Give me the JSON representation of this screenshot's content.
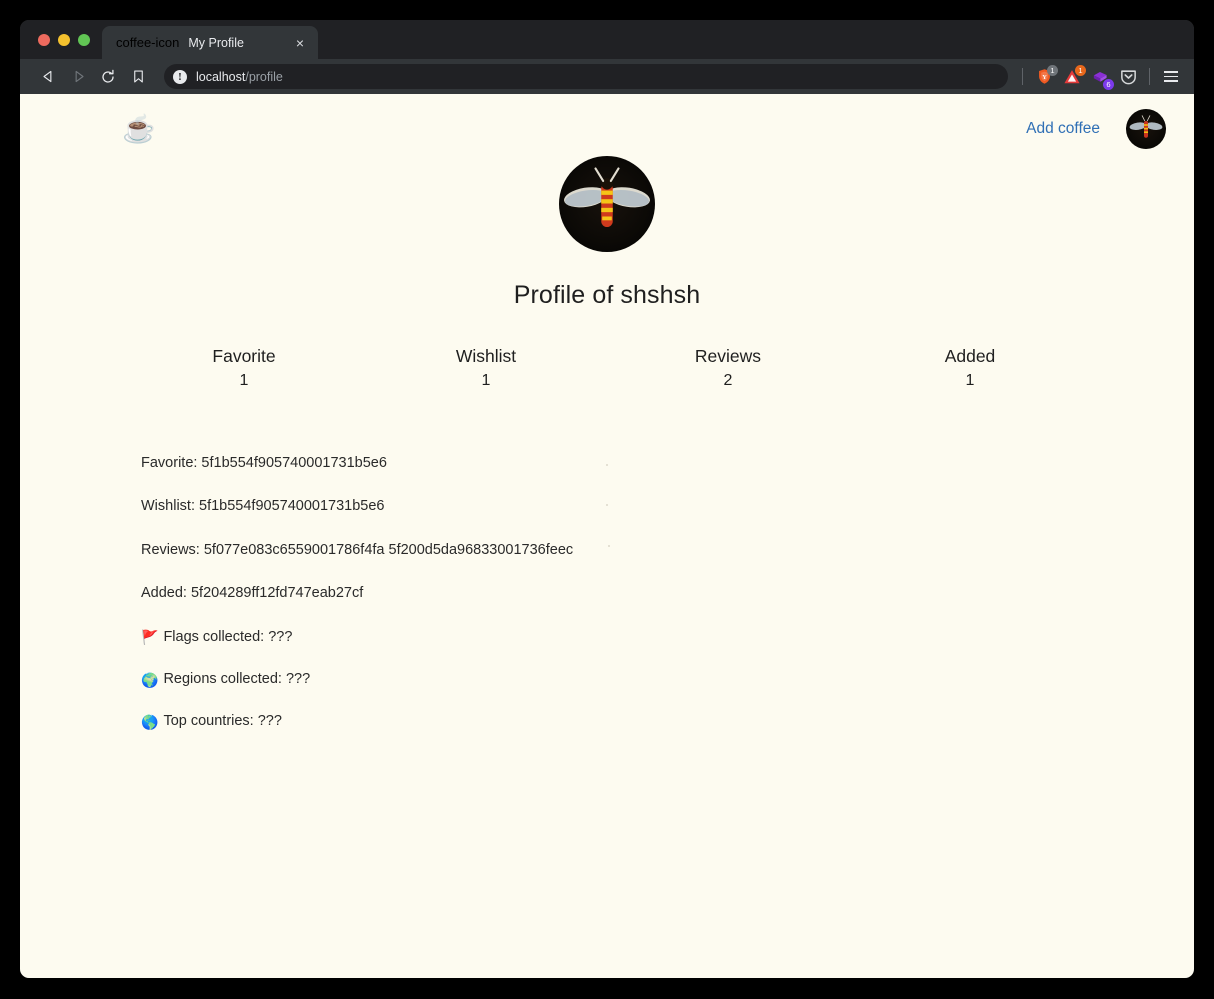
{
  "browser": {
    "traffic_lights": [
      "close",
      "minimize",
      "maximize"
    ],
    "tab": {
      "favicon": "coffee-icon",
      "title": "My Profile",
      "close_label": "×"
    },
    "nav": {
      "back_label": "back-icon",
      "forward_label": "forward-icon",
      "reload_label": "reload-icon",
      "bookmark_label": "bookmark-icon"
    },
    "url": {
      "site_info_icon": "!",
      "host": "localhost",
      "path": "/profile"
    },
    "toolbar_icons": [
      {
        "name": "brave-shields-icon",
        "badge": "1",
        "badge_color": "#70757a"
      },
      {
        "name": "warning-triangle-icon",
        "badge": "1",
        "badge_color": "#e8681c"
      },
      {
        "name": "extension-puzzle-icon",
        "badge": "6",
        "badge_color": "#7c3aed"
      },
      {
        "name": "pocket-icon",
        "badge": "",
        "badge_color": ""
      }
    ],
    "menu_label": "hamburger-menu-icon"
  },
  "page": {
    "brand_logo": "☕",
    "add_coffee_label": "Add coffee",
    "avatar_alt": "moth-avatar",
    "profile_title": "Profile of shshsh",
    "stats": [
      {
        "label": "Favorite",
        "value": "1"
      },
      {
        "label": "Wishlist",
        "value": "1"
      },
      {
        "label": "Reviews",
        "value": "2"
      },
      {
        "label": "Added",
        "value": "1"
      }
    ],
    "details": [
      {
        "key": "favorite",
        "text": "Favorite: 5f1b554f905740001731b5e6"
      },
      {
        "key": "wishlist",
        "text": "Wishlist: 5f1b554f905740001731b5e6"
      },
      {
        "key": "reviews",
        "text": "Reviews: 5f077e083c6559001786f4fa 5f200d5da96833001736feec"
      },
      {
        "key": "added",
        "text": "Added: 5f204289ff12fd747eab27cf"
      }
    ],
    "collections": [
      {
        "emoji": "🚩",
        "icon_name": "red-flag-icon",
        "text": "Flags collected: ???"
      },
      {
        "emoji": "🌍",
        "icon_name": "globe-europe-icon",
        "text": "Regions collected: ???"
      },
      {
        "emoji": "🌎",
        "icon_name": "globe-americas-icon",
        "text": "Top countries: ???"
      }
    ]
  },
  "colors": {
    "page_background": "#fdfbf0",
    "link_blue": "#2f6fb5",
    "chrome_dark": "#323639",
    "tabstrip_dark": "#202124",
    "text_primary": "#1f1f1f"
  }
}
